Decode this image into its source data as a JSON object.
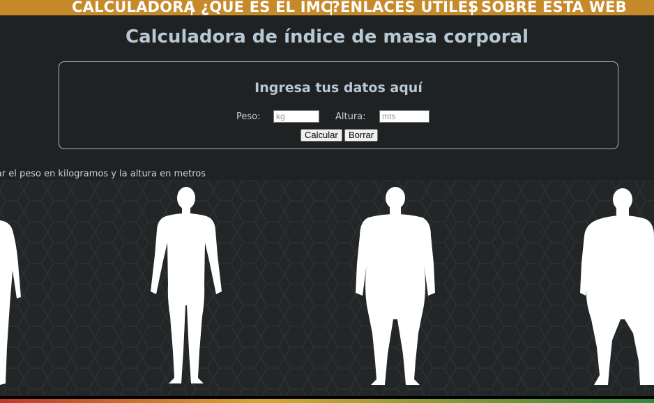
{
  "nav": {
    "items": [
      {
        "label": "CALCULADORA"
      },
      {
        "label": "¿QUÉ ES EL IMC?"
      },
      {
        "label": "ENLACES ÚTILES"
      },
      {
        "label": "SOBRE ESTA WEB"
      }
    ]
  },
  "page": {
    "title": "Calculadora de índice de masa corporal"
  },
  "form": {
    "title": "Ingresa tus datos aquí",
    "weight_label": "Peso:",
    "weight_placeholder": "kg",
    "height_label": "Altura:",
    "height_placeholder": "mts",
    "calc_label": "Calcular",
    "clear_label": "Borrar"
  },
  "hint": "sar el peso en kilogramos y la altura en metros",
  "colors": {
    "nav_bg": "#c68a2a",
    "page_bg": "#1f2223",
    "title": "#b8c8d4"
  }
}
